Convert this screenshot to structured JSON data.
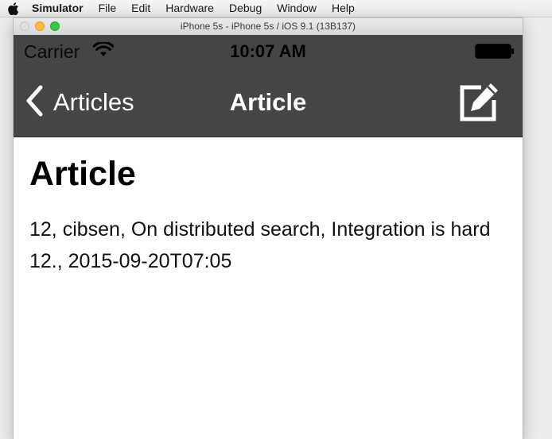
{
  "menubar": {
    "app_name": "Simulator",
    "items": [
      "File",
      "Edit",
      "Hardware",
      "Debug",
      "Window",
      "Help"
    ]
  },
  "window": {
    "title": "iPhone 5s - iPhone 5s / iOS 9.1 (13B137)"
  },
  "statusbar": {
    "carrier": "Carrier",
    "time": "10:07 AM"
  },
  "navbar": {
    "back_label": "Articles",
    "title": "Article",
    "bar_color": "#454545"
  },
  "article": {
    "heading": "Article",
    "body": "12, cibsen, On distributed search, Integration is hard 12., 2015-09-20T07:05"
  }
}
